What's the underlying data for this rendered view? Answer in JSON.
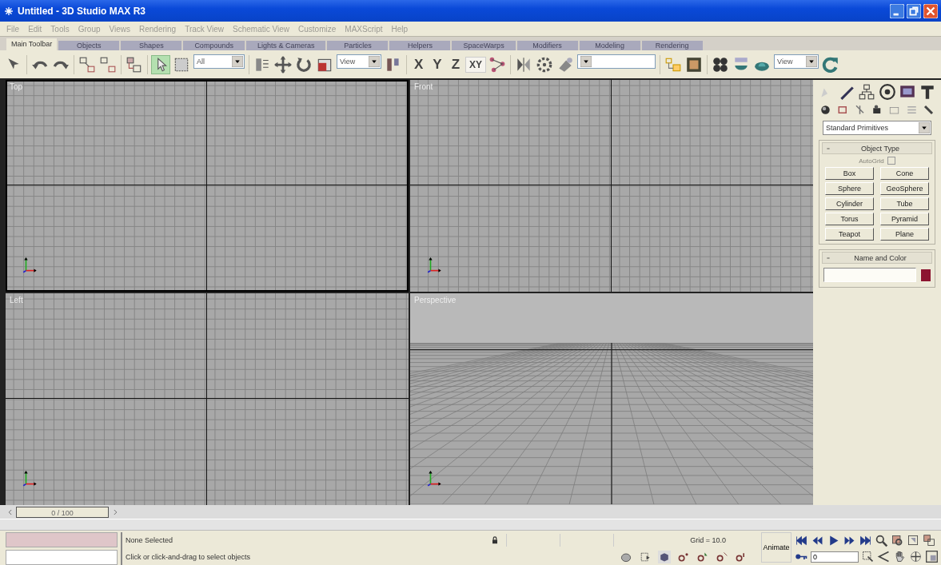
{
  "window": {
    "title": "Untitled - 3D Studio MAX R3"
  },
  "menu": [
    {
      "label": "File"
    },
    {
      "label": "Edit"
    },
    {
      "label": "Tools"
    },
    {
      "label": "Group"
    },
    {
      "label": "Views"
    },
    {
      "label": "Rendering"
    },
    {
      "label": "Track View"
    },
    {
      "label": "Schematic View"
    },
    {
      "label": "Customize"
    },
    {
      "label": "MAXScript"
    },
    {
      "label": "Help"
    }
  ],
  "tabs": [
    {
      "label": "Main Toolbar",
      "selected": true
    },
    {
      "label": "Objects",
      "selected": false
    },
    {
      "label": "Shapes",
      "selected": false
    },
    {
      "label": "Compounds",
      "selected": false
    },
    {
      "label": "Lights & Cameras",
      "selected": false
    },
    {
      "label": "Particles",
      "selected": false
    },
    {
      "label": "Helpers",
      "selected": false
    },
    {
      "label": "SpaceWarps",
      "selected": false
    },
    {
      "label": "Modifiers",
      "selected": false
    },
    {
      "label": "Modeling",
      "selected": false
    },
    {
      "label": "Rendering",
      "selected": false
    }
  ],
  "main_toolbar": {
    "select_object_selected": true,
    "selection_filter": "All",
    "reference_coordinates": "View",
    "axis_buttons": [
      {
        "label": "X",
        "selected": false
      },
      {
        "label": "Y",
        "selected": false
      },
      {
        "label": "Z",
        "selected": false
      },
      {
        "label": "XY",
        "selected": true
      }
    ],
    "render_type": "View"
  },
  "viewports": [
    {
      "label": "Top",
      "kind": "ortho",
      "selected": true
    },
    {
      "label": "Front",
      "kind": "ortho",
      "selected": false
    },
    {
      "label": "Left",
      "kind": "ortho",
      "selected": false
    },
    {
      "label": "Perspective",
      "kind": "perspective",
      "selected": false
    }
  ],
  "command_panel": {
    "category": "Standard Primitives",
    "object_type": {
      "title": "Object Type",
      "autogrid": {
        "label": "AutoGrid",
        "checked": false,
        "disabled": true
      },
      "buttons": [
        {
          "label": "Box"
        },
        {
          "label": "Cone"
        },
        {
          "label": "Sphere"
        },
        {
          "label": "GeoSphere"
        },
        {
          "label": "Cylinder"
        },
        {
          "label": "Tube"
        },
        {
          "label": "Torus"
        },
        {
          "label": "Pyramid"
        },
        {
          "label": "Teapot"
        },
        {
          "label": "Plane"
        }
      ]
    },
    "name_and_color": {
      "title": "Name and Color",
      "color": "#8c1430"
    }
  },
  "time_slider": {
    "frame": "0 / 100"
  },
  "status_bar": {
    "selection": "None Selected",
    "prompt": "Click or click-and-drag to select objects",
    "grid": "Grid = 10.0",
    "animate": {
      "label": "Animate",
      "on": false
    },
    "current_frame": "0"
  }
}
